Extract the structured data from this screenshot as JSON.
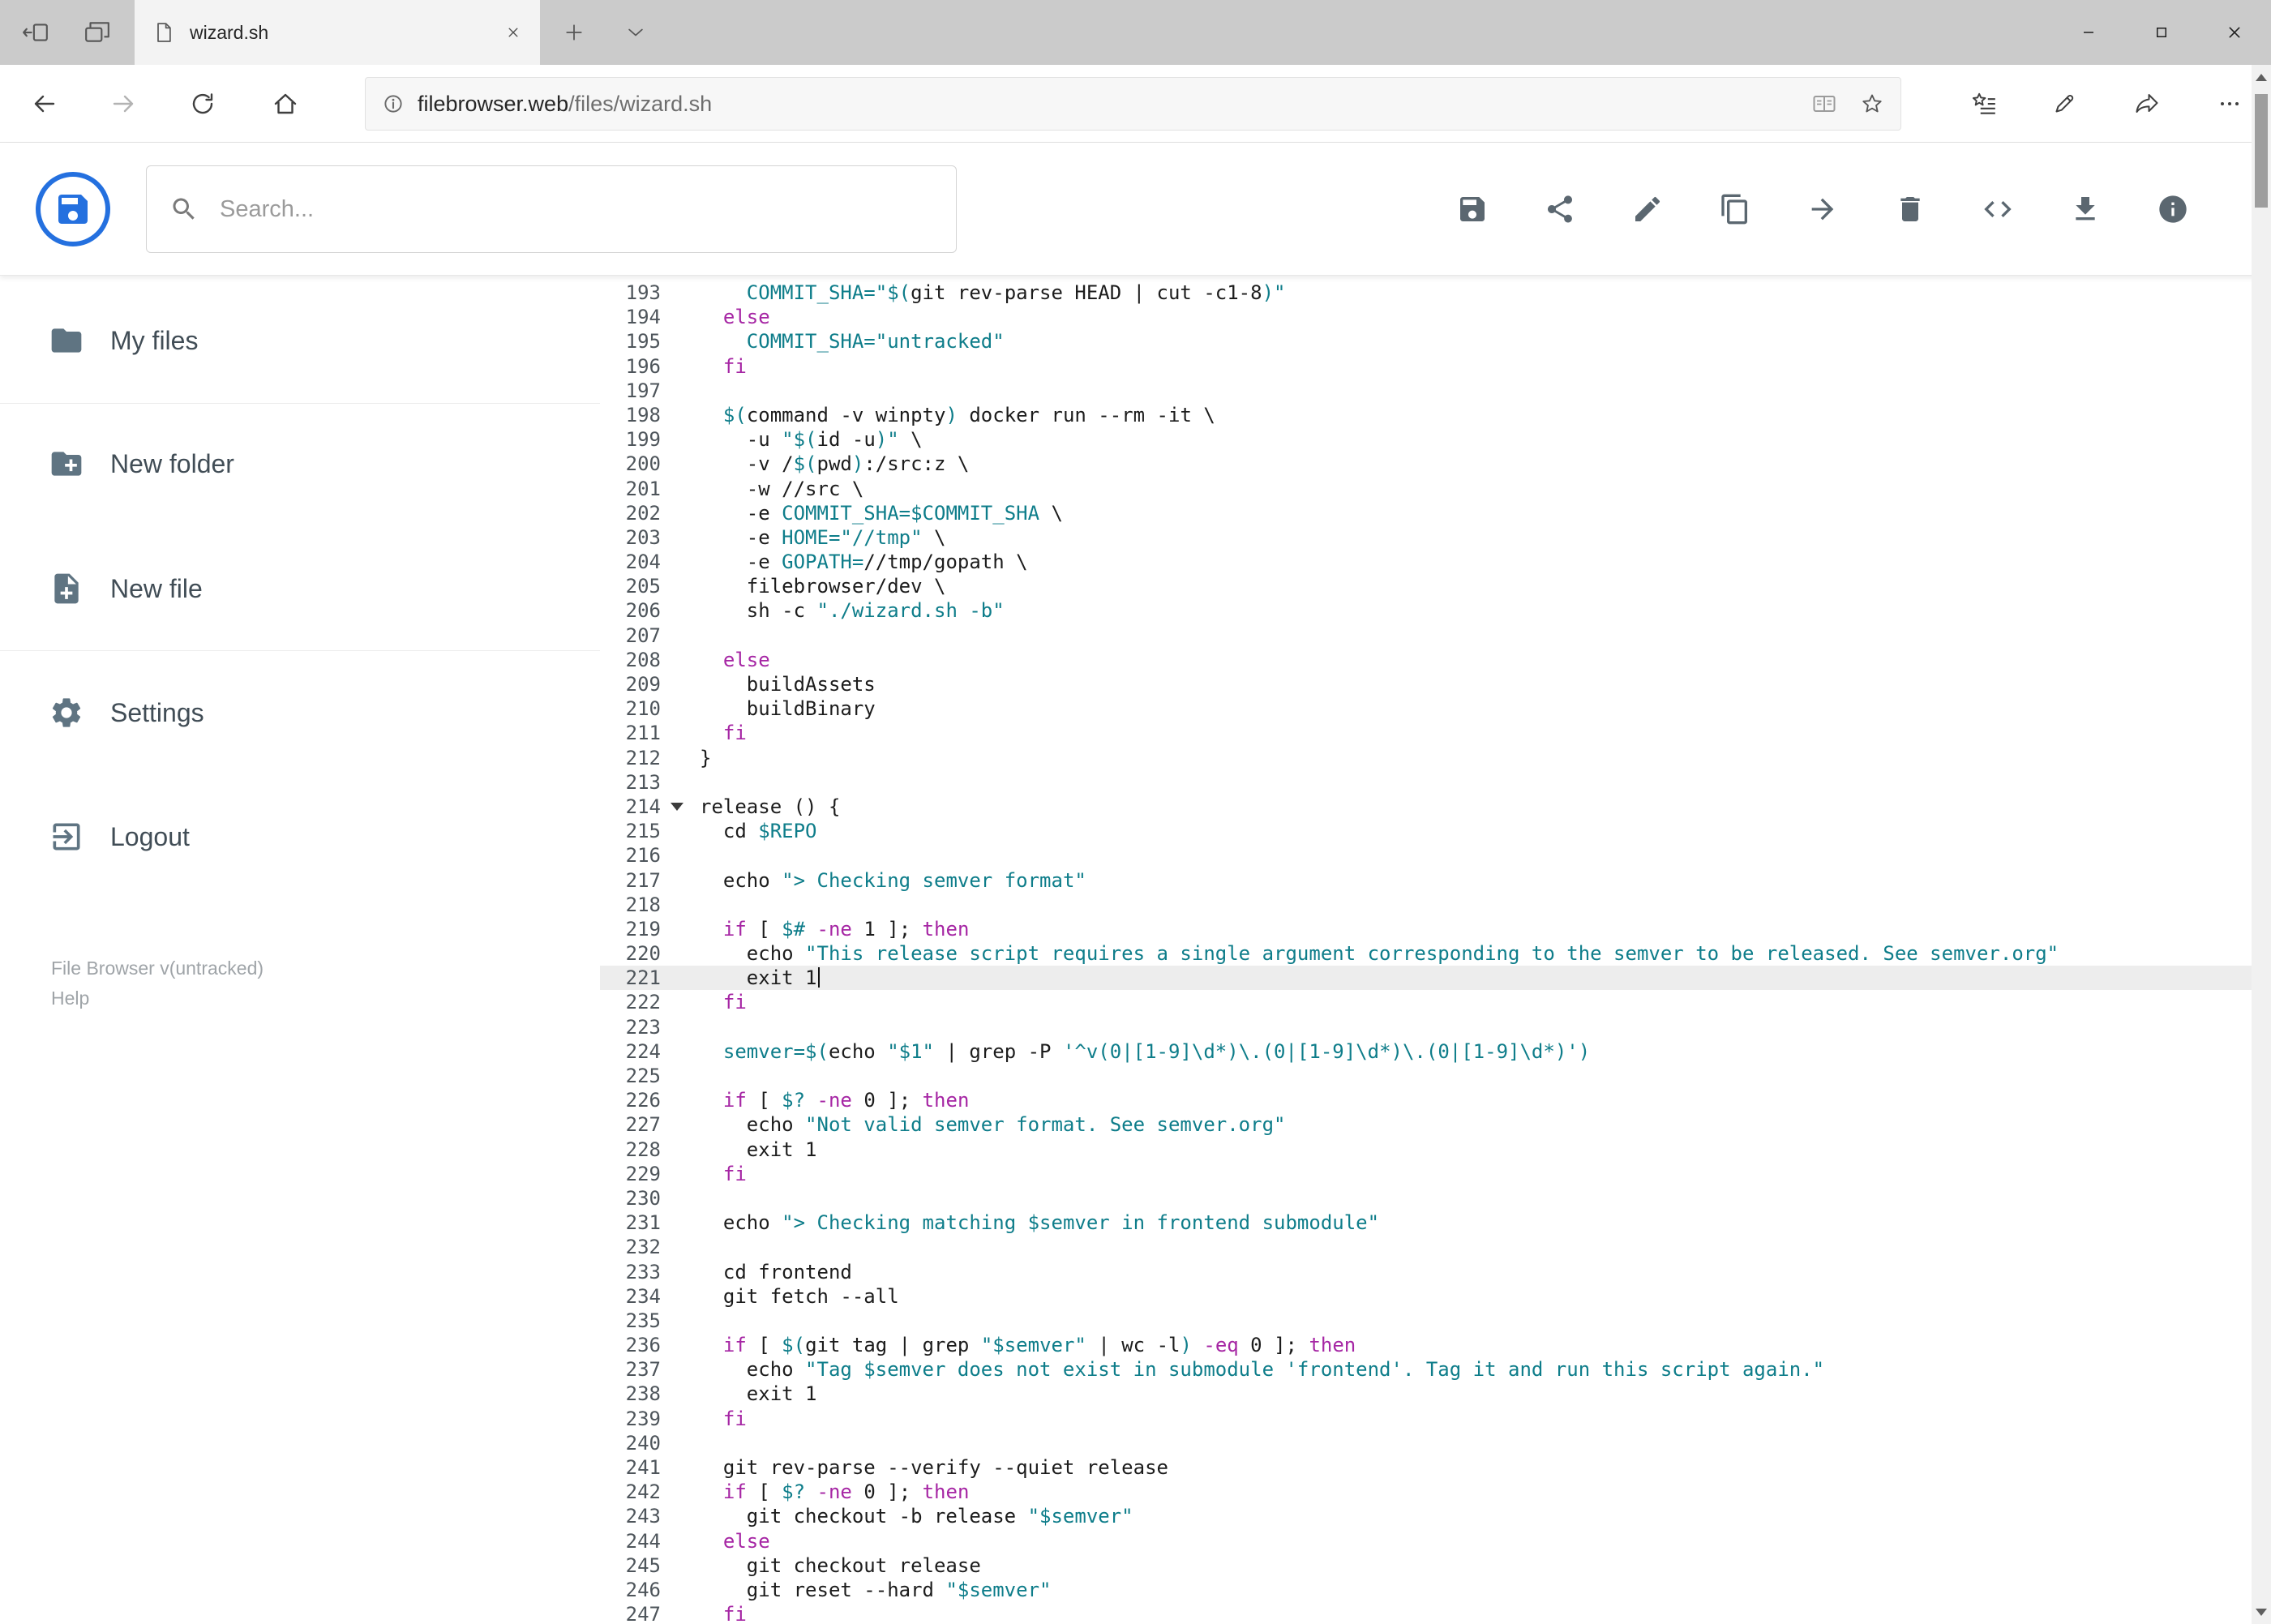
{
  "browser": {
    "tab_title": "wizard.sh",
    "url_domain": "filebrowser.web",
    "url_path": "/files/wizard.sh"
  },
  "header": {
    "search_placeholder": "Search...",
    "actions": [
      {
        "name": "save"
      },
      {
        "name": "share"
      },
      {
        "name": "edit"
      },
      {
        "name": "copy"
      },
      {
        "name": "move"
      },
      {
        "name": "delete"
      },
      {
        "name": "code"
      },
      {
        "name": "download"
      },
      {
        "name": "info"
      }
    ]
  },
  "sidebar": {
    "items": [
      {
        "icon": "folder",
        "label": "My files"
      },
      {
        "icon": "create-new-folder",
        "label": "New folder"
      },
      {
        "icon": "note-add",
        "label": "New file"
      },
      {
        "icon": "settings",
        "label": "Settings"
      },
      {
        "icon": "logout",
        "label": "Logout"
      }
    ],
    "footer": {
      "version": "File Browser v(untracked)",
      "help": "Help"
    }
  },
  "colors": {
    "accent_blue": "#2470df",
    "keyword_purple": "#a626a4",
    "string_teal": "#0e7d8a",
    "active_line_bg": "#ededed"
  },
  "editor": {
    "active_line": 221,
    "lines": [
      {
        "n": 193,
        "seg": [
          [
            "s",
            "    COMMIT_SHA=\"$("
          ],
          [
            "x",
            "git rev-parse HEAD | cut -c1-8"
          ],
          [
            "s",
            ")\""
          ]
        ]
      },
      {
        "n": 194,
        "seg": [
          [
            "x",
            "  "
          ],
          [
            "k",
            "else"
          ]
        ]
      },
      {
        "n": 195,
        "seg": [
          [
            "s",
            "    COMMIT_SHA=\"untracked\""
          ]
        ]
      },
      {
        "n": 196,
        "seg": [
          [
            "x",
            "  "
          ],
          [
            "k",
            "fi"
          ]
        ]
      },
      {
        "n": 197,
        "seg": []
      },
      {
        "n": 198,
        "seg": [
          [
            "x",
            "  "
          ],
          [
            "s",
            "$("
          ],
          [
            "x",
            "command -v winpty"
          ],
          [
            "s",
            ")"
          ],
          [
            "x",
            " docker run --rm -it \\"
          ]
        ]
      },
      {
        "n": 199,
        "seg": [
          [
            "x",
            "    -u "
          ],
          [
            "s",
            "\"$("
          ],
          [
            "x",
            "id -u"
          ],
          [
            "s",
            ")\""
          ],
          [
            "x",
            " \\"
          ]
        ]
      },
      {
        "n": 200,
        "seg": [
          [
            "x",
            "    -v /"
          ],
          [
            "s",
            "$("
          ],
          [
            "x",
            "pwd"
          ],
          [
            "s",
            ")"
          ],
          [
            "x",
            ":/src:z \\"
          ]
        ]
      },
      {
        "n": 201,
        "seg": [
          [
            "x",
            "    -w //src \\"
          ]
        ]
      },
      {
        "n": 202,
        "seg": [
          [
            "x",
            "    -e "
          ],
          [
            "s",
            "COMMIT_SHA=$COMMIT_SHA"
          ],
          [
            "x",
            " \\"
          ]
        ]
      },
      {
        "n": 203,
        "seg": [
          [
            "x",
            "    -e "
          ],
          [
            "s",
            "HOME=\"//tmp\""
          ],
          [
            "x",
            " \\"
          ]
        ]
      },
      {
        "n": 204,
        "seg": [
          [
            "x",
            "    -e "
          ],
          [
            "s",
            "GOPATH="
          ],
          [
            "x",
            "//tmp/gopath \\"
          ]
        ]
      },
      {
        "n": 205,
        "seg": [
          [
            "x",
            "    filebrowser/dev \\"
          ]
        ]
      },
      {
        "n": 206,
        "seg": [
          [
            "x",
            "    sh -c "
          ],
          [
            "s",
            "\"./wizard.sh -b\""
          ]
        ]
      },
      {
        "n": 207,
        "seg": []
      },
      {
        "n": 208,
        "seg": [
          [
            "x",
            "  "
          ],
          [
            "k",
            "else"
          ]
        ]
      },
      {
        "n": 209,
        "seg": [
          [
            "x",
            "    buildAssets"
          ]
        ]
      },
      {
        "n": 210,
        "seg": [
          [
            "x",
            "    buildBinary"
          ]
        ]
      },
      {
        "n": 211,
        "seg": [
          [
            "x",
            "  "
          ],
          [
            "k",
            "fi"
          ]
        ]
      },
      {
        "n": 212,
        "seg": [
          [
            "x",
            "}"
          ]
        ]
      },
      {
        "n": 213,
        "seg": []
      },
      {
        "n": 214,
        "fold": true,
        "seg": [
          [
            "x",
            "release () {"
          ]
        ]
      },
      {
        "n": 215,
        "seg": [
          [
            "x",
            "  cd "
          ],
          [
            "s",
            "$REPO"
          ]
        ]
      },
      {
        "n": 216,
        "seg": []
      },
      {
        "n": 217,
        "seg": [
          [
            "x",
            "  echo "
          ],
          [
            "s",
            "\"> Checking semver format\""
          ]
        ]
      },
      {
        "n": 218,
        "seg": []
      },
      {
        "n": 219,
        "seg": [
          [
            "x",
            "  "
          ],
          [
            "k",
            "if"
          ],
          [
            "x",
            " [ "
          ],
          [
            "s",
            "$#"
          ],
          [
            "x",
            " "
          ],
          [
            "k",
            "-ne"
          ],
          [
            "x",
            " 1 ]; "
          ],
          [
            "k",
            "then"
          ]
        ]
      },
      {
        "n": 220,
        "seg": [
          [
            "x",
            "    echo "
          ],
          [
            "s",
            "\"This release script requires a single argument corresponding to the semver to be released. See semver.org\""
          ]
        ]
      },
      {
        "n": 221,
        "cursor": true,
        "seg": [
          [
            "x",
            "    exit 1"
          ]
        ]
      },
      {
        "n": 222,
        "seg": [
          [
            "x",
            "  "
          ],
          [
            "k",
            "fi"
          ]
        ]
      },
      {
        "n": 223,
        "seg": []
      },
      {
        "n": 224,
        "seg": [
          [
            "x",
            "  "
          ],
          [
            "s",
            "semver=$("
          ],
          [
            "x",
            "echo "
          ],
          [
            "s",
            "\"$1\""
          ],
          [
            "x",
            " | grep -P "
          ],
          [
            "s",
            "'^v(0|[1-9]\\d*)\\.(0|[1-9]\\d*)\\.(0|[1-9]\\d*)'"
          ],
          [
            "s",
            ")"
          ]
        ]
      },
      {
        "n": 225,
        "seg": []
      },
      {
        "n": 226,
        "seg": [
          [
            "x",
            "  "
          ],
          [
            "k",
            "if"
          ],
          [
            "x",
            " [ "
          ],
          [
            "s",
            "$?"
          ],
          [
            "x",
            " "
          ],
          [
            "k",
            "-ne"
          ],
          [
            "x",
            " 0 ]; "
          ],
          [
            "k",
            "then"
          ]
        ]
      },
      {
        "n": 227,
        "seg": [
          [
            "x",
            "    echo "
          ],
          [
            "s",
            "\"Not valid semver format. See semver.org\""
          ]
        ]
      },
      {
        "n": 228,
        "seg": [
          [
            "x",
            "    exit 1"
          ]
        ]
      },
      {
        "n": 229,
        "seg": [
          [
            "x",
            "  "
          ],
          [
            "k",
            "fi"
          ]
        ]
      },
      {
        "n": 230,
        "seg": []
      },
      {
        "n": 231,
        "seg": [
          [
            "x",
            "  echo "
          ],
          [
            "s",
            "\"> Checking matching $semver in frontend submodule\""
          ]
        ]
      },
      {
        "n": 232,
        "seg": []
      },
      {
        "n": 233,
        "seg": [
          [
            "x",
            "  cd frontend"
          ]
        ]
      },
      {
        "n": 234,
        "seg": [
          [
            "x",
            "  git fetch --all"
          ]
        ]
      },
      {
        "n": 235,
        "seg": []
      },
      {
        "n": 236,
        "seg": [
          [
            "x",
            "  "
          ],
          [
            "k",
            "if"
          ],
          [
            "x",
            " [ "
          ],
          [
            "s",
            "$("
          ],
          [
            "x",
            "git tag | grep "
          ],
          [
            "s",
            "\"$semver\""
          ],
          [
            "x",
            " | wc -l"
          ],
          [
            "s",
            ")"
          ],
          [
            "x",
            " "
          ],
          [
            "k",
            "-eq"
          ],
          [
            "x",
            " 0 ]; "
          ],
          [
            "k",
            "then"
          ]
        ]
      },
      {
        "n": 237,
        "seg": [
          [
            "x",
            "    echo "
          ],
          [
            "s",
            "\"Tag $semver does not exist in submodule 'frontend'. Tag it and run this script again.\""
          ]
        ]
      },
      {
        "n": 238,
        "seg": [
          [
            "x",
            "    exit 1"
          ]
        ]
      },
      {
        "n": 239,
        "seg": [
          [
            "x",
            "  "
          ],
          [
            "k",
            "fi"
          ]
        ]
      },
      {
        "n": 240,
        "seg": []
      },
      {
        "n": 241,
        "seg": [
          [
            "x",
            "  git rev-parse --verify --quiet release"
          ]
        ]
      },
      {
        "n": 242,
        "seg": [
          [
            "x",
            "  "
          ],
          [
            "k",
            "if"
          ],
          [
            "x",
            " [ "
          ],
          [
            "s",
            "$?"
          ],
          [
            "x",
            " "
          ],
          [
            "k",
            "-ne"
          ],
          [
            "x",
            " 0 ]; "
          ],
          [
            "k",
            "then"
          ]
        ]
      },
      {
        "n": 243,
        "seg": [
          [
            "x",
            "    git checkout -b release "
          ],
          [
            "s",
            "\"$semver\""
          ]
        ]
      },
      {
        "n": 244,
        "seg": [
          [
            "x",
            "  "
          ],
          [
            "k",
            "else"
          ]
        ]
      },
      {
        "n": 245,
        "seg": [
          [
            "x",
            "    git checkout release"
          ]
        ]
      },
      {
        "n": 246,
        "seg": [
          [
            "x",
            "    git reset --hard "
          ],
          [
            "s",
            "\"$semver\""
          ]
        ]
      },
      {
        "n": 247,
        "seg": [
          [
            "x",
            "  "
          ],
          [
            "k",
            "fi"
          ]
        ]
      }
    ]
  }
}
